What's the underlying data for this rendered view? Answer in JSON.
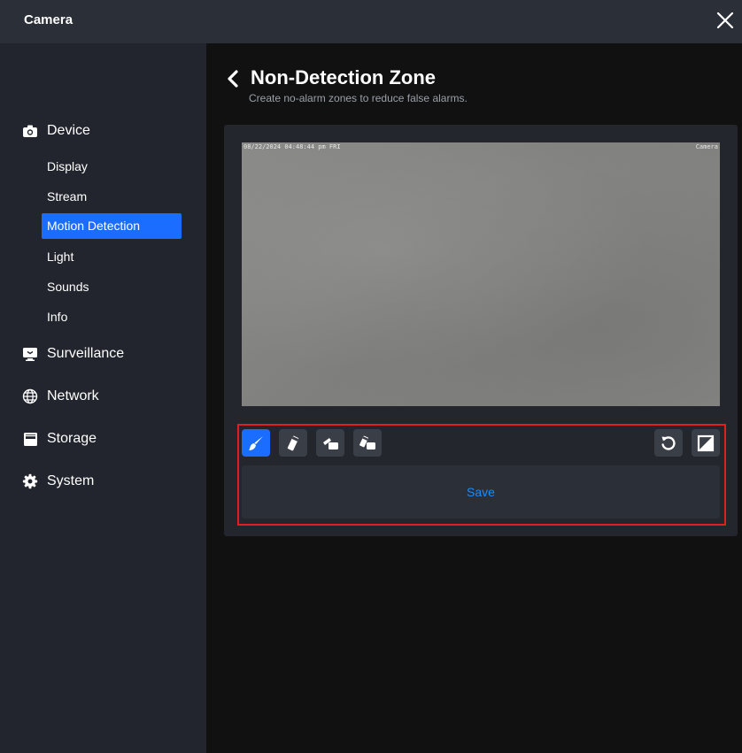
{
  "window": {
    "title": "Camera"
  },
  "sidebar": {
    "groups": [
      {
        "label": "Device",
        "icon": "camera-icon",
        "subitems": [
          "Display",
          "Stream",
          "Motion Detection",
          "Light",
          "Sounds",
          "Info"
        ],
        "active_subitem": "Motion Detection"
      },
      {
        "label": "Surveillance",
        "icon": "monitor-icon"
      },
      {
        "label": "Network",
        "icon": "globe-icon"
      },
      {
        "label": "Storage",
        "icon": "storage-icon"
      },
      {
        "label": "System",
        "icon": "gear-icon"
      }
    ]
  },
  "page": {
    "title": "Non-Detection Zone",
    "subtitle": "Create no-alarm zones to reduce false alarms."
  },
  "video": {
    "timestamp": "08/22/2024 04:48:44 pm FRI",
    "camera_name": "Camera"
  },
  "toolbar": {
    "tools": [
      "brush-icon",
      "eraser-icon",
      "fill-all-icon",
      "clear-all-icon"
    ],
    "active_tool": "brush-icon",
    "right_tools": [
      "undo-icon",
      "invert-icon"
    ],
    "save_label": "Save"
  },
  "colors": {
    "accent": "#1a6dff",
    "save_text": "#1a8cff",
    "highlight_border": "#e02020",
    "sidebar_bg": "#22252d",
    "titlebar_bg": "#2b2f38"
  }
}
